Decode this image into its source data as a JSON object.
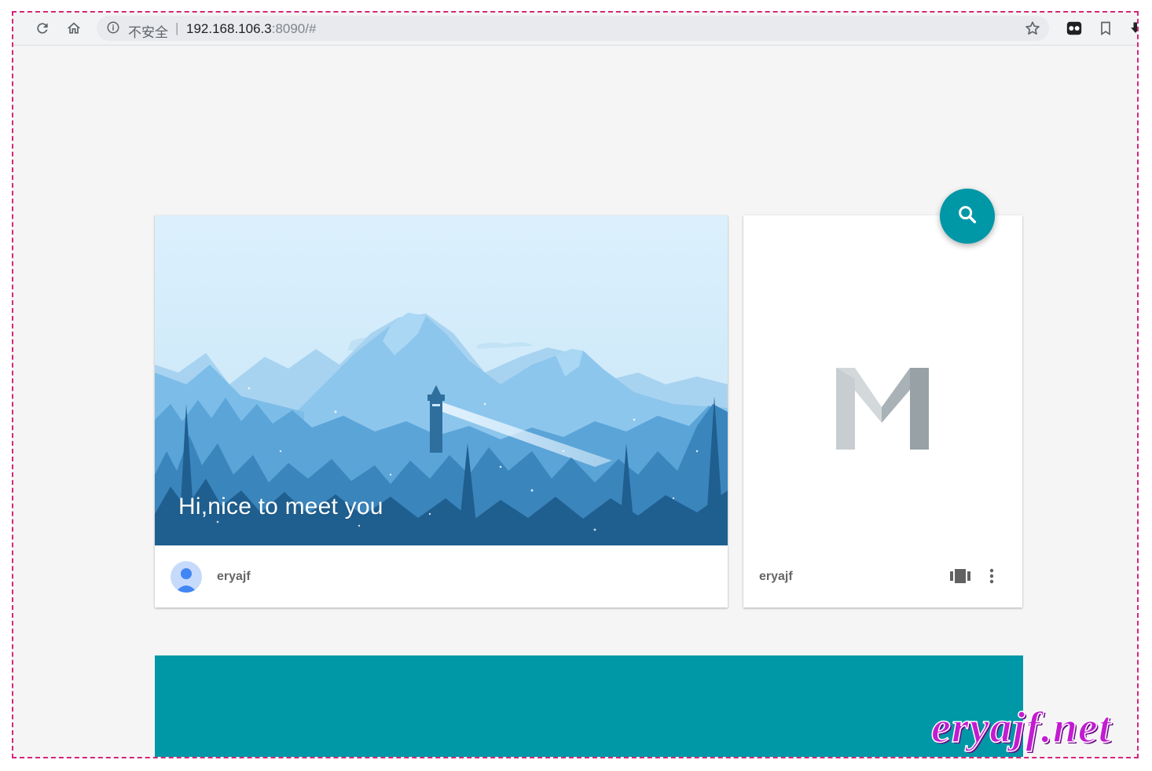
{
  "browser": {
    "security_label": "不安全",
    "separator": "|",
    "url_host": "192.168.106.3",
    "url_rest": ":8090/#",
    "icons": [
      "reload-icon",
      "home-icon",
      "info-icon",
      "bookmark-star-icon",
      "extension-icon",
      "bookmark-icon",
      "download-icon"
    ]
  },
  "hero_card": {
    "greeting": "Hi,nice to meet you",
    "author": "eryajf"
  },
  "side_card": {
    "author": "eryajf",
    "icons": [
      "carousel-icon",
      "more-vert-icon"
    ]
  },
  "fab": {
    "icon": "search-icon",
    "color": "#0097a7"
  },
  "watermark": "eryajf.net",
  "colors": {
    "accent": "#0097a7",
    "background": "#f5f5f5",
    "frame": "#d6267a"
  }
}
